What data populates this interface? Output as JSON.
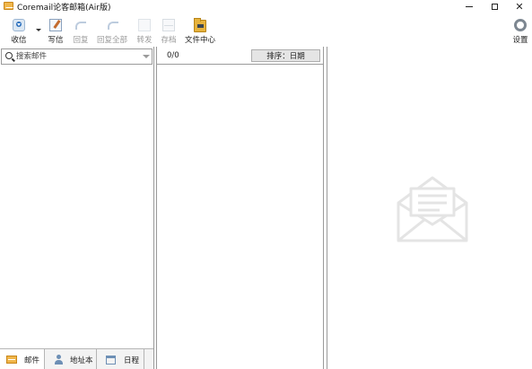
{
  "window": {
    "title": "Coremail论客邮箱(Air版)"
  },
  "toolbar": {
    "receive": "收信",
    "write": "写信",
    "reply": "回复",
    "reply_all": "回复全部",
    "forward": "转发",
    "archive": "存档",
    "file_center": "文件中心",
    "settings": "设置"
  },
  "search": {
    "placeholder": "搜索邮件"
  },
  "bottom_tabs": {
    "mail": "邮件",
    "contacts": "地址本",
    "calendar": "日程"
  },
  "mail_list": {
    "count": "0/0",
    "sort_label": "排序：日期"
  },
  "colors": {
    "accent_folder": "#e6b23c",
    "border": "#9a9a9a"
  }
}
